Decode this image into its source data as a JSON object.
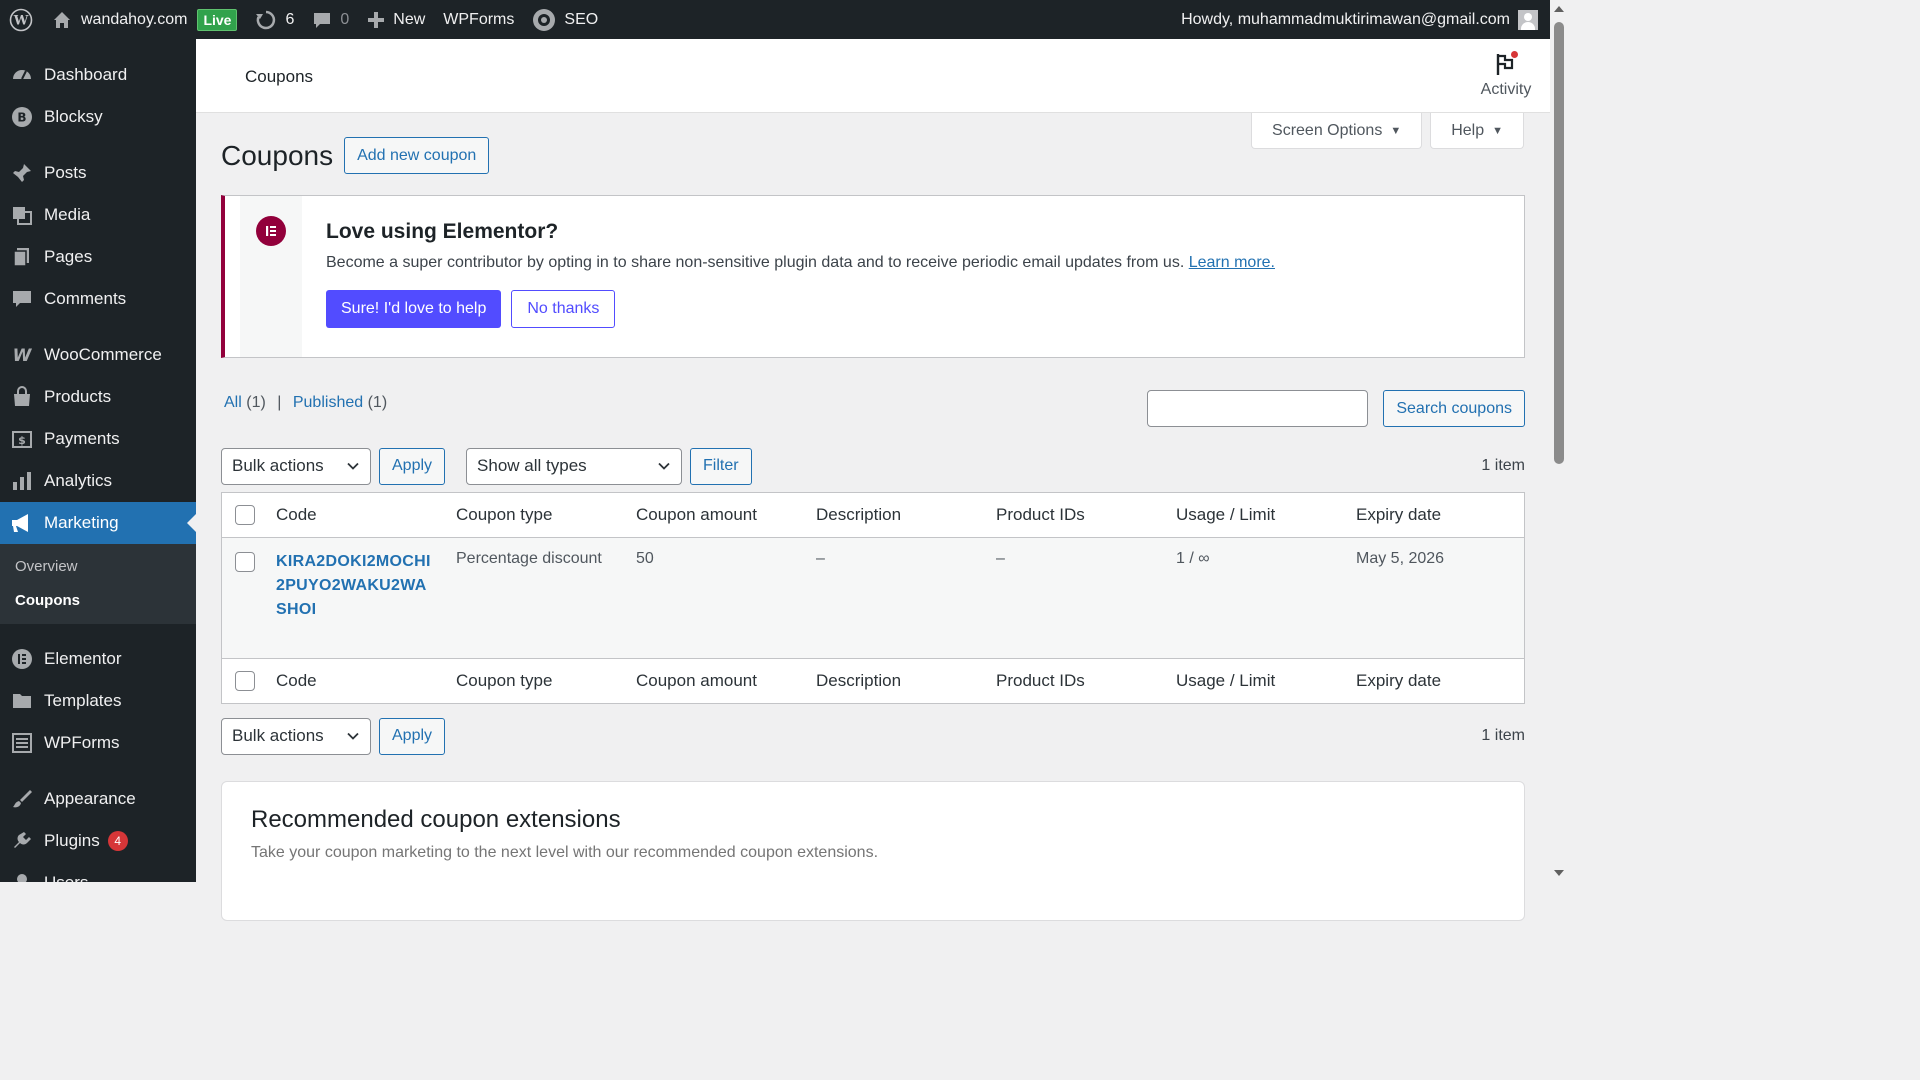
{
  "adminbar": {
    "site_name": "wandahoy.com",
    "live_label": "Live",
    "updates_count": "6",
    "comments_count": "0",
    "new_label": "New",
    "wpforms_label": "WPForms",
    "seo_label": "SEO",
    "howdy": "Howdy, muhammadmuktirimawan@gmail.com"
  },
  "sidebar": {
    "items": [
      {
        "label": "Dashboard",
        "icon": "dashboard-icon"
      },
      {
        "label": "Blocksy",
        "icon": "blocksy-icon"
      },
      {
        "label": "Posts",
        "icon": "pin-icon"
      },
      {
        "label": "Media",
        "icon": "media-icon"
      },
      {
        "label": "Pages",
        "icon": "pages-icon"
      },
      {
        "label": "Comments",
        "icon": "comment-icon"
      },
      {
        "label": "WooCommerce",
        "icon": "woo-icon"
      },
      {
        "label": "Products",
        "icon": "bag-icon"
      },
      {
        "label": "Payments",
        "icon": "payments-icon"
      },
      {
        "label": "Analytics",
        "icon": "bar-chart-icon"
      },
      {
        "label": "Marketing",
        "icon": "megaphone-icon"
      },
      {
        "label": "Elementor",
        "icon": "elementor-icon"
      },
      {
        "label": "Templates",
        "icon": "folder-icon"
      },
      {
        "label": "WPForms",
        "icon": "form-icon"
      },
      {
        "label": "Appearance",
        "icon": "brush-icon"
      },
      {
        "label": "Plugins",
        "icon": "plug-icon"
      },
      {
        "label": "Users",
        "icon": "user-icon"
      }
    ],
    "submenu": [
      "Overview",
      "Coupons"
    ],
    "plugins_badge": "4"
  },
  "header": {
    "title": "Coupons",
    "activity_label": "Activity"
  },
  "screen_meta": {
    "screen_options": "Screen Options",
    "help": "Help"
  },
  "page": {
    "title": "Coupons",
    "add_new": "Add new coupon"
  },
  "notice": {
    "title": "Love using Elementor?",
    "text": "Become a super contributor by opting in to share non-sensitive plugin data and to receive periodic email updates from us.",
    "learn_more": "Learn more.",
    "accept": "Sure! I'd love to help",
    "decline": "No thanks"
  },
  "filters": {
    "all": "All",
    "all_count": "(1)",
    "published": "Published",
    "published_count": "(1)",
    "search_button": "Search coupons",
    "bulk_actions": "Bulk actions",
    "apply": "Apply",
    "show_all_types": "Show all types",
    "filter": "Filter",
    "items_count": "1 item"
  },
  "table": {
    "columns": [
      "Code",
      "Coupon type",
      "Coupon amount",
      "Description",
      "Product IDs",
      "Usage / Limit",
      "Expiry date"
    ],
    "rows": [
      {
        "code": "KIRA2DOKI2MOCHI2PUYO2WAKU2WASHOI",
        "type": "Percentage discount",
        "amount": "50",
        "description": "–",
        "product_ids": "–",
        "usage": "1 / ∞",
        "expiry": "May 5, 2026"
      }
    ]
  },
  "recommended": {
    "title": "Recommended coupon extensions",
    "text": "Take your coupon marketing to the next level with our recommended coupon extensions."
  },
  "colors": {
    "admin_dark": "#1d2327",
    "accent_blue": "#2271b1",
    "elementor": "#92003b",
    "elementor_button": "#524cff",
    "badge_red": "#d63638",
    "live_green": "#31a24c"
  }
}
